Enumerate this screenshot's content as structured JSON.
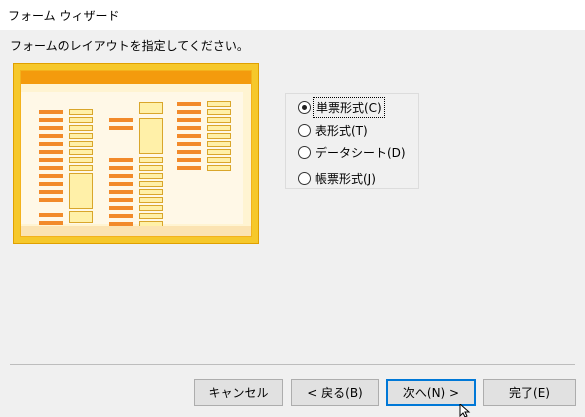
{
  "window": {
    "title": "フォーム ウィザード"
  },
  "instruction": "フォームのレイアウトを指定してください。",
  "layout_options": [
    {
      "label": "単票形式(C)",
      "selected": true
    },
    {
      "label": "表形式(T)",
      "selected": false
    },
    {
      "label": "データシート(D)",
      "selected": false
    },
    {
      "label": "帳票形式(J)",
      "selected": false
    }
  ],
  "buttons": {
    "cancel": "キャンセル",
    "back": "< 戻る(B)",
    "next": "次へ(N) >",
    "finish": "完了(E)"
  },
  "colors": {
    "preview_frame": "#f6c82b",
    "preview_header": "#f49b0d",
    "preview_label": "#f28a2a",
    "preview_field": "#fff0a8",
    "default_button_border": "#0078d7"
  }
}
